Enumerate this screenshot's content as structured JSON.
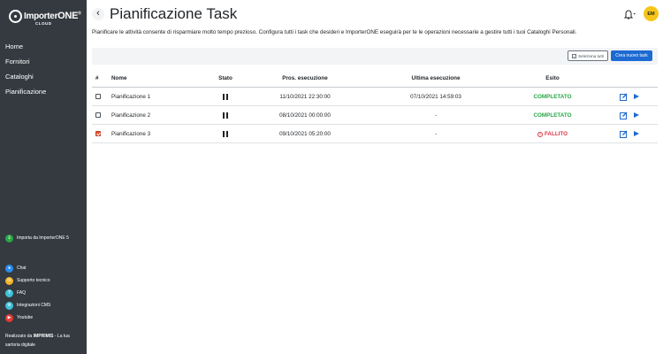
{
  "brand": {
    "name": "Importer",
    "name_suffix": "ONE",
    "sub": "CLOUD",
    "mark": "®"
  },
  "sidebar": {
    "nav": [
      {
        "label": "Home"
      },
      {
        "label": "Fornitori"
      },
      {
        "label": "Cataloghi"
      },
      {
        "label": "Pianificazione"
      }
    ],
    "import_link": {
      "label": "Importa da ImporterONE 5",
      "icon": "import-icon",
      "color": "#28a745"
    },
    "links": [
      {
        "label": "Chat",
        "icon": "chat-icon",
        "color": "#2b8ef0"
      },
      {
        "label": "Supporto tecnico",
        "icon": "support-icon",
        "color": "#f0b429"
      },
      {
        "label": "FAQ",
        "icon": "faq-icon",
        "color": "#3fc1d9"
      },
      {
        "label": "Integrazioni CMS",
        "icon": "cms-icon",
        "color": "#3fc1d9"
      },
      {
        "label": "Youtube",
        "icon": "youtube-icon",
        "color": "#e53935"
      }
    ],
    "credits": {
      "prefix": "Realizzato da",
      "company": "IMPRIMIS",
      "suffix": " - La tua sartoria digitale"
    }
  },
  "header": {
    "title": "Pianificazione Task",
    "description": "Pianificare le attività consente di risparmiare molto tempo prezioso. Configura tutti i task che desideri e ImporterONE eseguirà per te le operazioni necessarie a gestire tutti i tuoi Cataloghi Personali.",
    "avatar": "EM"
  },
  "toolbar": {
    "select_all": "Seleziona tutti",
    "new_task": "Crea nuovo task"
  },
  "table": {
    "headers": {
      "num": "#",
      "name": "Nome",
      "state": "Stato",
      "next": "Pros. esecuzione",
      "last": "Ultima esecuzione",
      "outcome": "Esito"
    },
    "rows": [
      {
        "checked": false,
        "name": "Pianificazione 1",
        "state": "pause-icon",
        "next": "11/10/2021 22:30:00",
        "last": "07/10/2021 14:59:03",
        "outcome": "COMPLETATO",
        "status": "ok"
      },
      {
        "checked": false,
        "name": "Pianificazione 2",
        "state": "pause-icon",
        "next": "08/10/2021 00:00:00",
        "last": "-",
        "outcome": "COMPLETATO",
        "status": "ok"
      },
      {
        "checked": true,
        "name": "Pianificazione 3",
        "state": "pause-icon",
        "next": "09/10/2021 05:20:00",
        "last": "-",
        "outcome": "FALLITO",
        "status": "ko"
      }
    ]
  },
  "colors": {
    "sidebar_bg": "#343a40",
    "primary": "#1d6ad2",
    "success": "#28a745",
    "danger": "#dc3545",
    "avatar": "#f5c518"
  }
}
